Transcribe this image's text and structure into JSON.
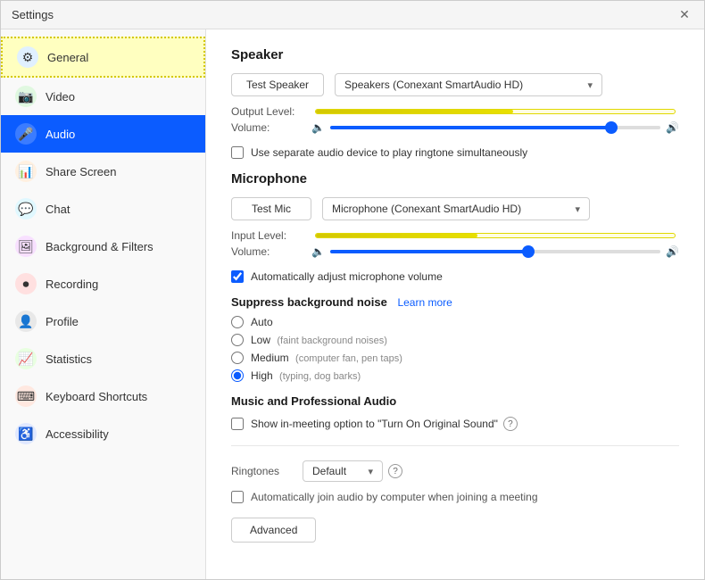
{
  "titlebar": {
    "title": "Settings",
    "close_label": "✕"
  },
  "sidebar": {
    "items": [
      {
        "id": "general",
        "label": "General",
        "icon": "⚙",
        "icon_class": "icon-general",
        "active": false,
        "highlighted": true
      },
      {
        "id": "video",
        "label": "Video",
        "icon": "📷",
        "icon_class": "icon-video",
        "active": false,
        "highlighted": false
      },
      {
        "id": "audio",
        "label": "Audio",
        "icon": "🎤",
        "icon_class": "icon-audio",
        "active": true,
        "highlighted": false
      },
      {
        "id": "share-screen",
        "label": "Share Screen",
        "icon": "📊",
        "icon_class": "icon-share",
        "active": false,
        "highlighted": false
      },
      {
        "id": "chat",
        "label": "Chat",
        "icon": "💬",
        "icon_class": "icon-chat",
        "active": false,
        "highlighted": false
      },
      {
        "id": "background-filters",
        "label": "Background & Filters",
        "icon": "🖼",
        "icon_class": "icon-bg",
        "active": false,
        "highlighted": false
      },
      {
        "id": "recording",
        "label": "Recording",
        "icon": "⏺",
        "icon_class": "icon-recording",
        "active": false,
        "highlighted": false
      },
      {
        "id": "profile",
        "label": "Profile",
        "icon": "👤",
        "icon_class": "icon-profile",
        "active": false,
        "highlighted": false
      },
      {
        "id": "statistics",
        "label": "Statistics",
        "icon": "📈",
        "icon_class": "icon-stats",
        "active": false,
        "highlighted": false
      },
      {
        "id": "keyboard-shortcuts",
        "label": "Keyboard Shortcuts",
        "icon": "⌨",
        "icon_class": "icon-keyboard",
        "active": false,
        "highlighted": false
      },
      {
        "id": "accessibility",
        "label": "Accessibility",
        "icon": "♿",
        "icon_class": "icon-accessibility",
        "active": false,
        "highlighted": false
      }
    ]
  },
  "main": {
    "speaker": {
      "title": "Speaker",
      "test_btn": "Test Speaker",
      "dropdown_value": "Speakers (Conexant SmartAudio HD)",
      "output_level_label": "Output Level:",
      "output_level_pct": 55,
      "volume_label": "Volume:",
      "volume_pct": 85
    },
    "separate_audio_checkbox": {
      "checked": false,
      "label": "Use separate audio device to play ringtone simultaneously"
    },
    "microphone": {
      "title": "Microphone",
      "test_btn": "Test Mic",
      "dropdown_value": "Microphone (Conexant SmartAudio HD)",
      "input_level_label": "Input Level:",
      "input_level_pct": 45,
      "volume_label": "Volume:",
      "volume_pct": 60
    },
    "auto_adjust_checkbox": {
      "checked": true,
      "label": "Automatically adjust microphone volume"
    },
    "suppress_noise": {
      "title": "Suppress background noise",
      "learn_more": "Learn more",
      "options": [
        {
          "id": "auto",
          "label": "Auto",
          "sub": "",
          "checked": false
        },
        {
          "id": "low",
          "label": "Low",
          "sub": "(faint background noises)",
          "checked": false
        },
        {
          "id": "medium",
          "label": "Medium",
          "sub": "(computer fan, pen taps)",
          "checked": false
        },
        {
          "id": "high",
          "label": "High",
          "sub": "(typing, dog barks)",
          "checked": true
        }
      ]
    },
    "music_audio": {
      "title": "Music and Professional Audio",
      "show_option_checkbox": {
        "checked": false,
        "label": "Show in-meeting option to \"Turn On Original Sound\""
      }
    },
    "ringtones": {
      "label": "Ringtones",
      "value": "Default",
      "help": "?"
    },
    "auto_join": {
      "checked": false,
      "label": "Automatically join audio by computer when joining a meeting"
    },
    "advanced_btn": "Advanced"
  }
}
